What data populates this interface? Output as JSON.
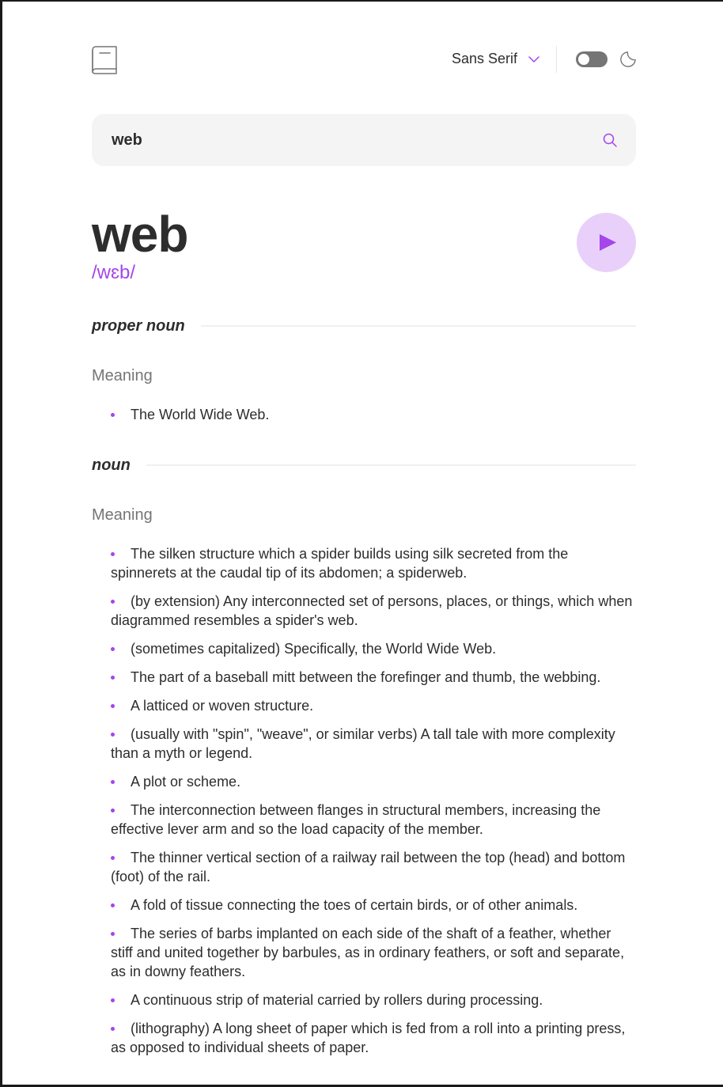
{
  "header": {
    "font_selector": "Sans Serif",
    "theme_toggle_state": "off"
  },
  "search": {
    "value": "web",
    "placeholder": ""
  },
  "entry": {
    "word": "web",
    "phonetic": "/wɛb/",
    "meanings": [
      {
        "part_of_speech": "proper noun",
        "heading": "Meaning",
        "definitions": [
          "The World Wide Web."
        ]
      },
      {
        "part_of_speech": "noun",
        "heading": "Meaning",
        "definitions": [
          "The silken structure which a spider builds using silk secreted from the spinnerets at the caudal tip of its abdomen; a spiderweb.",
          "(by extension) Any interconnected set of persons, places, or things, which when diagrammed resembles a spider's web.",
          "(sometimes capitalized) Specifically, the World Wide Web.",
          "The part of a baseball mitt between the forefinger and thumb, the webbing.",
          "A latticed or woven structure.",
          "(usually with \"spin\", \"weave\", or similar verbs) A tall tale with more complexity than a myth or legend.",
          "A plot or scheme.",
          "The interconnection between flanges in structural members, increasing the effective lever arm and so the load capacity of the member.",
          "The thinner vertical section of a railway rail between the top (head) and bottom (foot) of the rail.",
          "A fold of tissue connecting the toes of certain birds, or of other animals.",
          "The series of barbs implanted on each side of the shaft of a feather, whether stiff and united together by barbules, as in ordinary feathers, or soft and separate, as in downy feathers.",
          "A continuous strip of material carried by rollers during processing.",
          "(lithography) A long sheet of paper which is fed from a roll into a printing press, as opposed to individual sheets of paper."
        ]
      }
    ]
  },
  "colors": {
    "accent": "#a445ed",
    "accent_light": "#e9d0fa",
    "text": "#2d2d2d",
    "muted": "#757575",
    "search_bg": "#f4f4f4"
  },
  "icons": {
    "logo": "book-icon",
    "dropdown": "chevron-down-icon",
    "theme": "moon-icon",
    "search": "search-icon",
    "play": "play-icon"
  }
}
